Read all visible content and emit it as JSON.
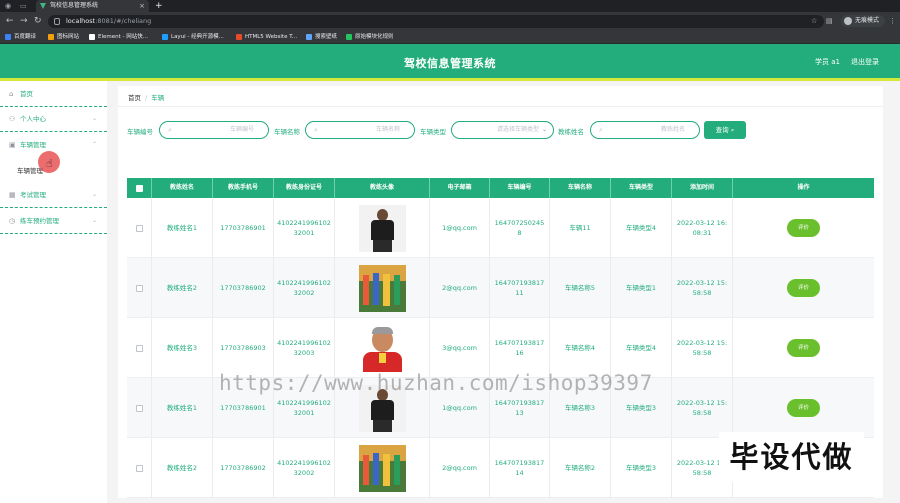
{
  "browser": {
    "tab_title": "驾校信息管理系统",
    "new_tab": "+",
    "url_host": "localhost",
    "url_rest": ":8081/#/cheliang",
    "profile": "无痕模式",
    "bookmarks": [
      "百度翻译",
      "图标网站",
      "Element - 网站快...",
      "Layui - 经典开源模...",
      "HTML5 Website T...",
      "搜索壁纸",
      "原始模块化规则"
    ],
    "bookmark_colors": [
      "#3b82f6",
      "#f59e0b",
      "#ffffff",
      "#1e9fff",
      "#e34c26",
      "#60a5fa",
      "#22c55e"
    ]
  },
  "header": {
    "title": "驾校信息管理系统",
    "user": "学员 a1",
    "logout": "退出登录"
  },
  "sidebar": {
    "items": [
      {
        "label": "首页",
        "icon": "home-icon",
        "glyph": "⌂"
      },
      {
        "label": "个人中心",
        "icon": "user-icon",
        "glyph": "👤"
      },
      {
        "label": "车辆管理",
        "icon": "car-icon",
        "glyph": "▣"
      },
      {
        "label": "考试管理",
        "icon": "grid-icon",
        "glyph": "▦"
      },
      {
        "label": "练车预约管理",
        "icon": "clock-icon",
        "glyph": "◷"
      }
    ],
    "sub_item": "车辆管理"
  },
  "breadcrumb": {
    "home": "首页",
    "sep": "/",
    "current": "车辆"
  },
  "search": {
    "plate_label": "车辆编号",
    "plate_placeholder": "车辆编号",
    "name_label": "车辆名称",
    "name_placeholder": "车辆名称",
    "type_label": "车辆类型",
    "type_placeholder": "请选择车辆类型",
    "coach_label": "教练姓名",
    "coach_placeholder": "教练姓名",
    "button": "查询",
    "mag": "⌕",
    "arrow": "⌄"
  },
  "table": {
    "columns": [
      "教练姓名",
      "教练手机号",
      "教练身份证号",
      "教练头像",
      "电子邮箱",
      "车辆编号",
      "车辆名称",
      "车辆类型",
      "添加时间",
      "操作"
    ],
    "action_label": "评价",
    "rows": [
      {
        "coach": "教练姓名1",
        "phone": "17703786901",
        "id_card": "410224199610232001",
        "avatar": "coach-photo-1",
        "email": "1@qq.com",
        "plate": "1647072502458",
        "car_name": "车辆11",
        "car_type": "车辆类型4",
        "time": "2022-03-12 16:08:31"
      },
      {
        "coach": "教练姓名2",
        "phone": "17703786902",
        "id_card": "410224199610232002",
        "avatar": "coach-photo-2",
        "email": "2@qq.com",
        "plate": "16470719381711",
        "car_name": "车辆名称5",
        "car_type": "车辆类型1",
        "time": "2022-03-12 15:58:58"
      },
      {
        "coach": "教练姓名3",
        "phone": "17703786903",
        "id_card": "410224199610232003",
        "avatar": "coach-photo-3",
        "email": "3@qq.com",
        "plate": "16470719381716",
        "car_name": "车辆名称4",
        "car_type": "车辆类型4",
        "time": "2022-03-12 15:58:58"
      },
      {
        "coach": "教练姓名1",
        "phone": "17703786901",
        "id_card": "410224199610232001",
        "avatar": "coach-photo-1",
        "email": "1@qq.com",
        "plate": "16470719381713",
        "car_name": "车辆名称3",
        "car_type": "车辆类型3",
        "time": "2022-03-12 15:58:58"
      },
      {
        "coach": "教练姓名2",
        "phone": "17703786902",
        "id_card": "410224199610232002",
        "avatar": "coach-photo-2",
        "email": "2@qq.com",
        "plate": "16470719381714",
        "car_name": "车辆名称2",
        "car_type": "车辆类型3",
        "time": "2022-03-12 15:58:58"
      }
    ]
  },
  "overlay": {
    "watermark": "https://www.huzhan.com/ishop39397",
    "banner": "毕设代做"
  },
  "colors": {
    "accent": "#23ad7c",
    "header_border": "#d4e83a",
    "review_button": "#6abf2c"
  }
}
